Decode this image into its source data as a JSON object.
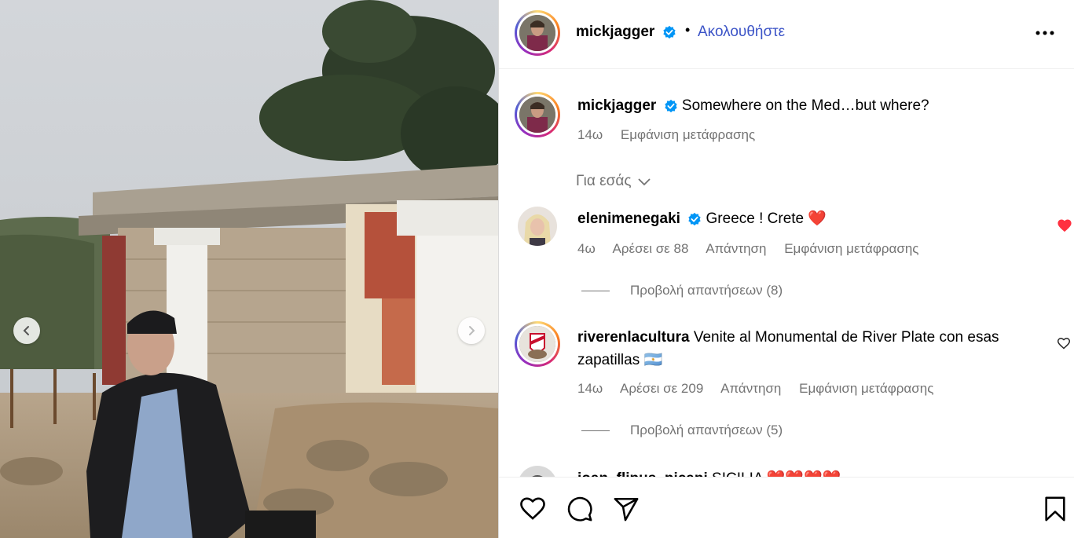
{
  "post": {
    "username": "mickjagger",
    "dot": "•",
    "follow_label": "Ακολουθήστε",
    "caption": "Somewhere on the Med…but where?",
    "caption_time": "14ω",
    "caption_translate": "Εμφάνιση μετάφρασης"
  },
  "filter_label": "Για εσάς",
  "comments": [
    {
      "username": "elenimenegaki",
      "text": "Greece ! Crete",
      "emoji": "❤️",
      "time": "4ω",
      "likes": "Αρέσει σε 88",
      "reply": "Απάντηση",
      "translate": "Εμφάνιση μετάφρασης",
      "view_replies": "Προβολή απαντήσεων (8)",
      "liked": true
    },
    {
      "username": "riverenlacultura",
      "text": "Venite al Monumental de River Plate con esas",
      "text2": "zapatillas 🇦🇷",
      "time": "14ω",
      "likes": "Αρέσει σε 209",
      "reply": "Απάντηση",
      "translate": "Εμφάνιση μετάφρασης",
      "view_replies": "Προβολή απαντήσεων (5)",
      "liked": false
    },
    {
      "username": "joan_flipus_picapi",
      "text": "SICILIA ❤️❤️❤️❤️"
    }
  ],
  "colors": {
    "link_blue": "#3c54c7",
    "verified_blue": "#0095f6",
    "muted": "#737373",
    "heart_red": "#ff3040"
  },
  "icons": [
    "verified-badge-icon",
    "more-options-icon",
    "chevron-down-icon",
    "heart-icon",
    "comment-icon",
    "share-icon",
    "bookmark-icon",
    "chevron-left-icon",
    "chevron-right-icon"
  ]
}
